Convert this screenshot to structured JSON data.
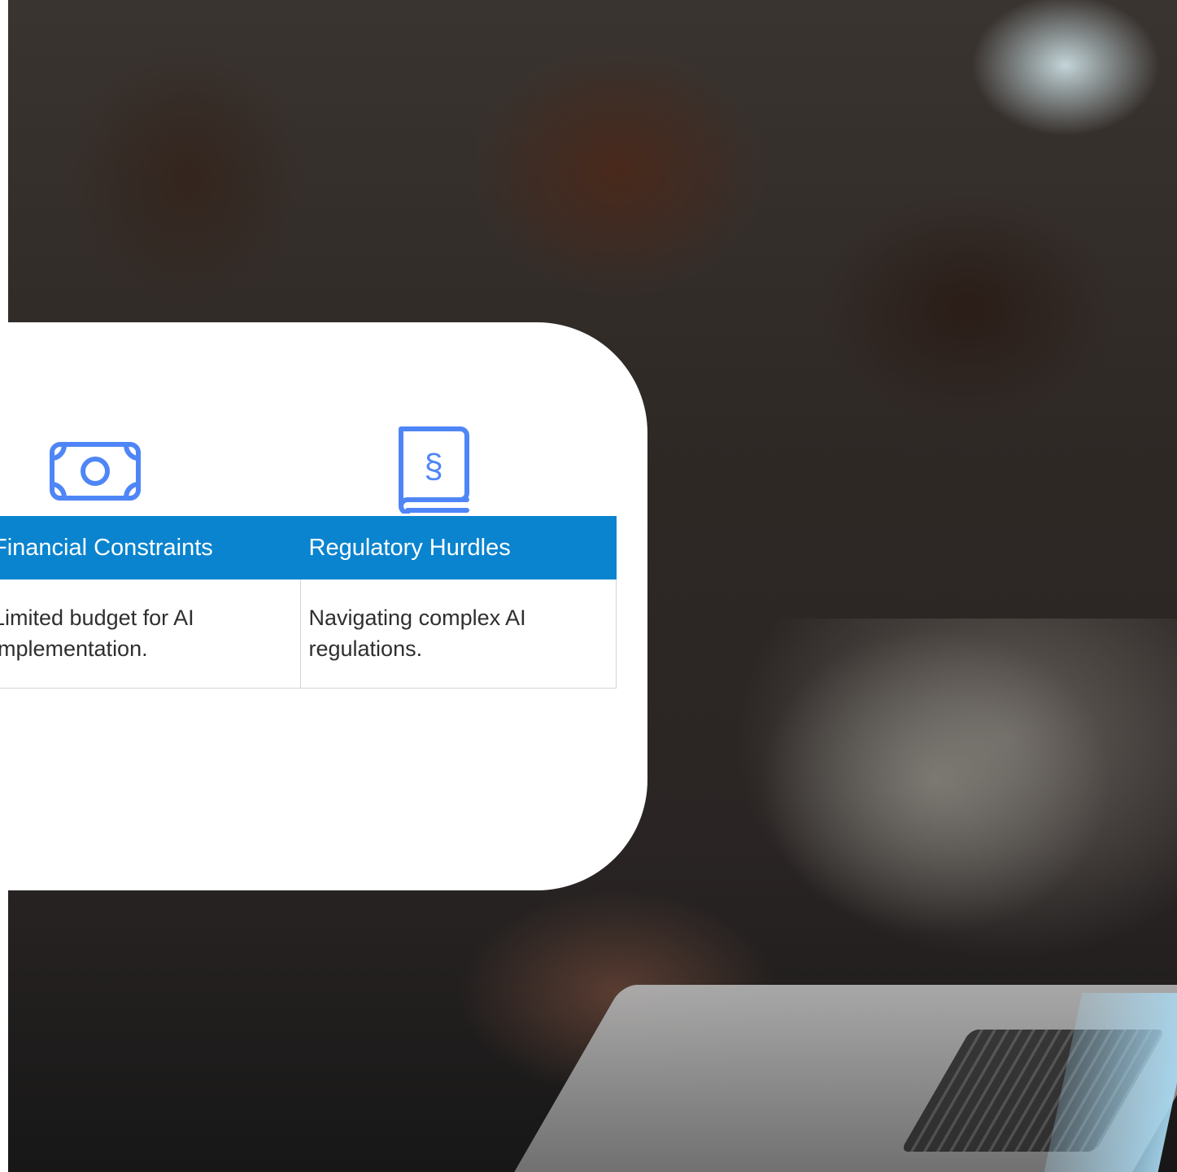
{
  "table": {
    "headers": [
      "Financial Constraints",
      "Regulatory Hurdles"
    ],
    "rows": [
      [
        "Limited budget for AI implementation.",
        "Navigating complex AI regulations."
      ]
    ]
  },
  "icons": {
    "financial": "money-bill-icon",
    "regulatory": "law-book-icon"
  },
  "colors": {
    "accent": "#0a84cf",
    "icon": "#4f86f7",
    "card": "#ffffff"
  }
}
